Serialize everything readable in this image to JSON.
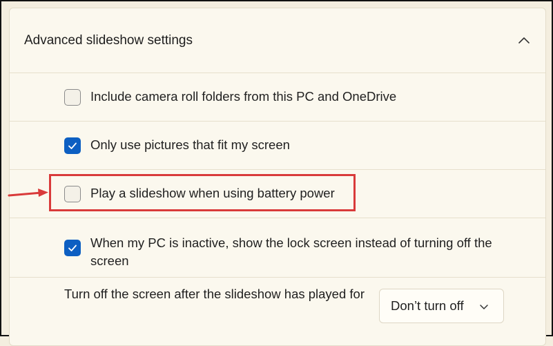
{
  "section": {
    "title": "Advanced slideshow settings",
    "collapse_icon": "chevron-up-icon"
  },
  "options": [
    {
      "label": "Include camera roll folders from this PC and OneDrive",
      "checked": false
    },
    {
      "label": "Only use pictures that fit my screen",
      "checked": true
    },
    {
      "label": "Play a slideshow when using battery power",
      "checked": false
    },
    {
      "label": "When my PC is inactive, show the lock screen instead of turning off the screen",
      "checked": true
    }
  ],
  "screen_off": {
    "label": "Turn off the screen after the slideshow has played for",
    "selected": "Don’t turn off",
    "chevron_icon": "chevron-down-icon"
  },
  "annotation": {
    "highlight_color": "#d93a3a",
    "arrow_icon": "arrow-right-icon"
  },
  "colors": {
    "accent": "#0d5fc2",
    "background": "#fbf8ee"
  }
}
